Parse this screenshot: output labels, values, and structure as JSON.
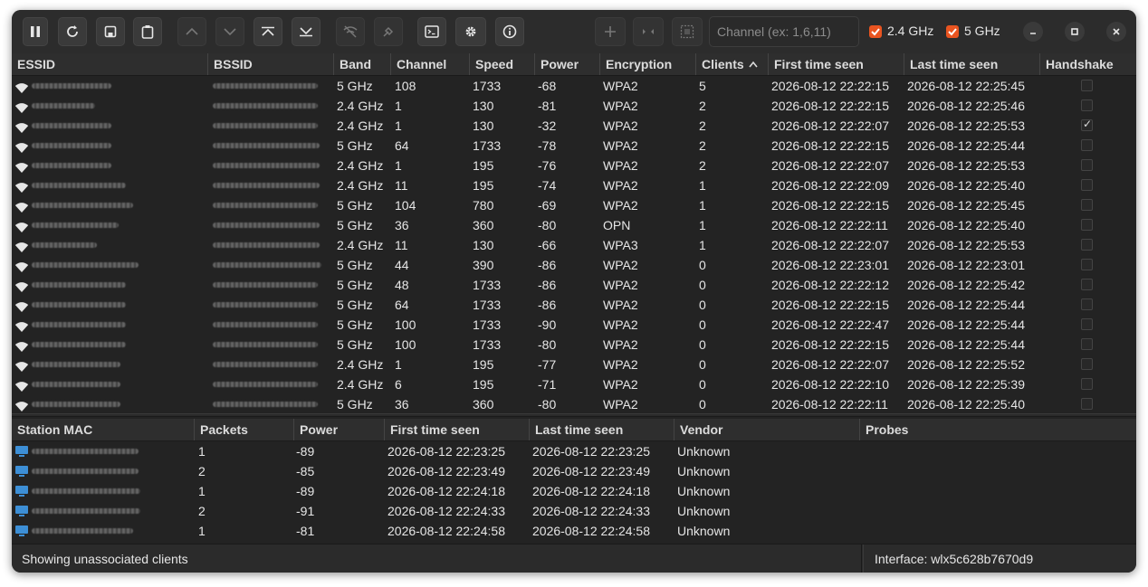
{
  "toolbar": {
    "channel_placeholder": "Channel (ex: 1,6,11)",
    "band24_label": "2.4 GHz",
    "band5_label": "5 GHz"
  },
  "ap_table": {
    "columns": [
      "ESSID",
      "BSSID",
      "Band",
      "Channel",
      "Speed",
      "Power",
      "Encryption",
      "Clients",
      "First time seen",
      "Last time seen",
      "Handshake"
    ],
    "sort_indicator": "^",
    "rows": [
      {
        "band": "5 GHz",
        "channel": "108",
        "speed": "1733",
        "power": "-68",
        "enc": "WPA2",
        "clients": "5",
        "first": "2026-08-12 22:22:15",
        "last": "2026-08-12 22:25:45",
        "handshake": false
      },
      {
        "band": "2.4 GHz",
        "channel": "1",
        "speed": "130",
        "power": "-81",
        "enc": "WPA2",
        "clients": "2",
        "first": "2026-08-12 22:22:15",
        "last": "2026-08-12 22:25:46",
        "handshake": false
      },
      {
        "band": "2.4 GHz",
        "channel": "1",
        "speed": "130",
        "power": "-32",
        "enc": "WPA2",
        "clients": "2",
        "first": "2026-08-12 22:22:07",
        "last": "2026-08-12 22:25:53",
        "handshake": true
      },
      {
        "band": "5 GHz",
        "channel": "64",
        "speed": "1733",
        "power": "-78",
        "enc": "WPA2",
        "clients": "2",
        "first": "2026-08-12 22:22:15",
        "last": "2026-08-12 22:25:44",
        "handshake": false
      },
      {
        "band": "2.4 GHz",
        "channel": "1",
        "speed": "195",
        "power": "-76",
        "enc": "WPA2",
        "clients": "2",
        "first": "2026-08-12 22:22:07",
        "last": "2026-08-12 22:25:53",
        "handshake": false
      },
      {
        "band": "2.4 GHz",
        "channel": "11",
        "speed": "195",
        "power": "-74",
        "enc": "WPA2",
        "clients": "1",
        "first": "2026-08-12 22:22:09",
        "last": "2026-08-12 22:25:40",
        "handshake": false
      },
      {
        "band": "5 GHz",
        "channel": "104",
        "speed": "780",
        "power": "-69",
        "enc": "WPA2",
        "clients": "1",
        "first": "2026-08-12 22:22:15",
        "last": "2026-08-12 22:25:45",
        "handshake": false
      },
      {
        "band": "5 GHz",
        "channel": "36",
        "speed": "360",
        "power": "-80",
        "enc": "OPN",
        "clients": "1",
        "first": "2026-08-12 22:22:11",
        "last": "2026-08-12 22:25:40",
        "handshake": false
      },
      {
        "band": "2.4 GHz",
        "channel": "11",
        "speed": "130",
        "power": "-66",
        "enc": "WPA3",
        "clients": "1",
        "first": "2026-08-12 22:22:07",
        "last": "2026-08-12 22:25:53",
        "handshake": false
      },
      {
        "band": "5 GHz",
        "channel": "44",
        "speed": "390",
        "power": "-86",
        "enc": "WPA2",
        "clients": "0",
        "first": "2026-08-12 22:23:01",
        "last": "2026-08-12 22:23:01",
        "handshake": false
      },
      {
        "band": "5 GHz",
        "channel": "48",
        "speed": "1733",
        "power": "-86",
        "enc": "WPA2",
        "clients": "0",
        "first": "2026-08-12 22:22:12",
        "last": "2026-08-12 22:25:42",
        "handshake": false
      },
      {
        "band": "5 GHz",
        "channel": "64",
        "speed": "1733",
        "power": "-86",
        "enc": "WPA2",
        "clients": "0",
        "first": "2026-08-12 22:22:15",
        "last": "2026-08-12 22:25:44",
        "handshake": false
      },
      {
        "band": "5 GHz",
        "channel": "100",
        "speed": "1733",
        "power": "-90",
        "enc": "WPA2",
        "clients": "0",
        "first": "2026-08-12 22:22:47",
        "last": "2026-08-12 22:25:44",
        "handshake": false
      },
      {
        "band": "5 GHz",
        "channel": "100",
        "speed": "1733",
        "power": "-80",
        "enc": "WPA2",
        "clients": "0",
        "first": "2026-08-12 22:22:15",
        "last": "2026-08-12 22:25:44",
        "handshake": false
      },
      {
        "band": "2.4 GHz",
        "channel": "1",
        "speed": "195",
        "power": "-77",
        "enc": "WPA2",
        "clients": "0",
        "first": "2026-08-12 22:22:07",
        "last": "2026-08-12 22:25:52",
        "handshake": false
      },
      {
        "band": "2.4 GHz",
        "channel": "6",
        "speed": "195",
        "power": "-71",
        "enc": "WPA2",
        "clients": "0",
        "first": "2026-08-12 22:22:10",
        "last": "2026-08-12 22:25:39",
        "handshake": false
      },
      {
        "band": "5 GHz",
        "channel": "36",
        "speed": "360",
        "power": "-80",
        "enc": "WPA2",
        "clients": "0",
        "first": "2026-08-12 22:22:11",
        "last": "2026-08-12 22:25:40",
        "handshake": false
      }
    ]
  },
  "station_table": {
    "columns": [
      "Station MAC",
      "Packets",
      "Power",
      "First time seen",
      "Last time seen",
      "Vendor",
      "Probes"
    ],
    "rows": [
      {
        "packets": "1",
        "power": "-89",
        "first": "2026-08-12 22:23:25",
        "last": "2026-08-12 22:23:25",
        "vendor": "Unknown"
      },
      {
        "packets": "2",
        "power": "-85",
        "first": "2026-08-12 22:23:49",
        "last": "2026-08-12 22:23:49",
        "vendor": "Unknown"
      },
      {
        "packets": "1",
        "power": "-89",
        "first": "2026-08-12 22:24:18",
        "last": "2026-08-12 22:24:18",
        "vendor": "Unknown"
      },
      {
        "packets": "2",
        "power": "-91",
        "first": "2026-08-12 22:24:33",
        "last": "2026-08-12 22:24:33",
        "vendor": "Unknown"
      },
      {
        "packets": "1",
        "power": "-81",
        "first": "2026-08-12 22:24:58",
        "last": "2026-08-12 22:24:58",
        "vendor": "Unknown"
      }
    ]
  },
  "status": {
    "left": "Showing unassociated clients",
    "right": "Interface: wlx5c628b7670d9"
  },
  "colors": {
    "accent": "#e95420",
    "bg": "#232323",
    "device_icon": "#3d8fd6"
  }
}
